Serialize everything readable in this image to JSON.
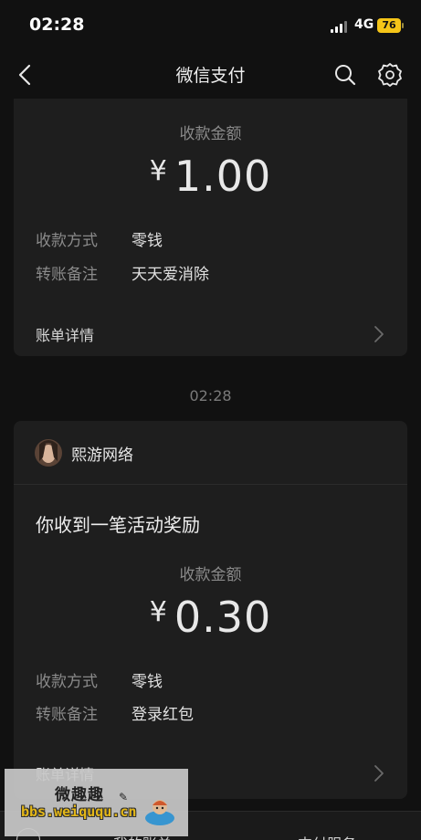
{
  "status": {
    "time": "02:28",
    "network": "4G",
    "battery": "76"
  },
  "nav": {
    "title": "微信支付"
  },
  "transactions": [
    {
      "amount_label": "收款金额",
      "currency": "¥",
      "amount": "1.00",
      "details": [
        {
          "key": "收款方式",
          "value": "零钱"
        },
        {
          "key": "转账备注",
          "value": "天天爱消除"
        }
      ],
      "bill_label": "账单详情"
    },
    {
      "timestamp": "02:28",
      "sender": "熙游网络",
      "headline": "你收到一笔活动奖励",
      "amount_label": "收款金额",
      "currency": "¥",
      "amount": "0.30",
      "details": [
        {
          "key": "收款方式",
          "value": "零钱"
        },
        {
          "key": "转账备注",
          "value": "登录红包"
        }
      ],
      "bill_label": "账单详情"
    }
  ],
  "watermark": {
    "title": "微趣趣",
    "url": "bbs.weiququ.cn"
  },
  "tabs": [
    {
      "label": "我的账单"
    },
    {
      "label": "支付服务"
    }
  ],
  "colors": {
    "background": "#111111",
    "card": "#1e1e1e",
    "battery": "#f5c518"
  }
}
